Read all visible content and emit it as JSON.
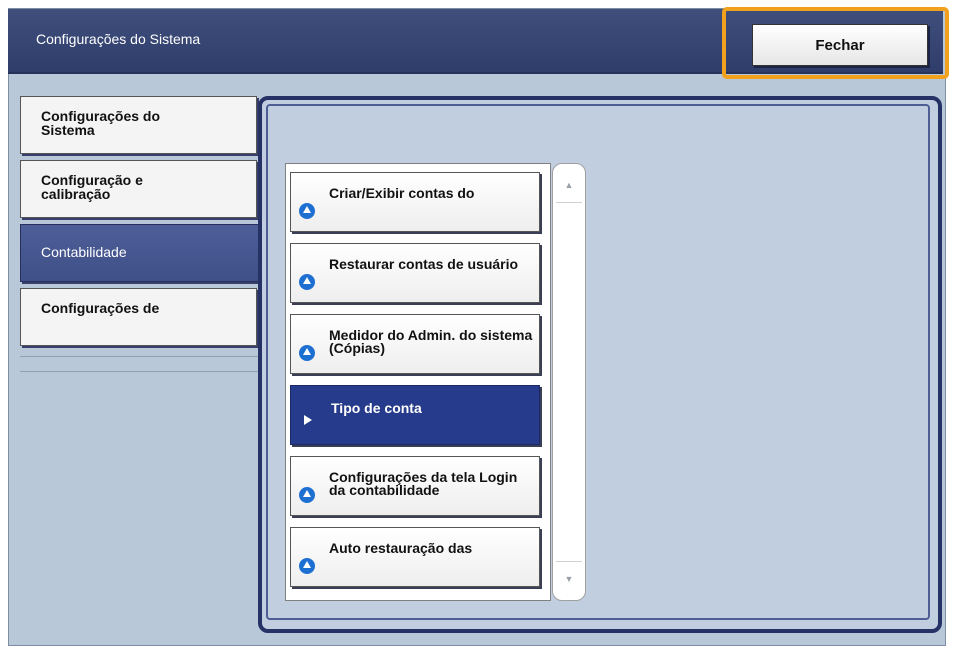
{
  "header": {
    "title": "Configurações do Sistema",
    "close_label": "Fechar",
    "highlight_color": "#f2a11f"
  },
  "sidebar": {
    "items": [
      {
        "label": "Configurações do\nSistema",
        "selected": false
      },
      {
        "label": "Configuração e\ncalibração",
        "selected": false
      },
      {
        "label": "Contabilidade",
        "selected": true
      },
      {
        "label": "Configurações de",
        "selected": false
      }
    ]
  },
  "menu": {
    "items": [
      {
        "label": "Criar/Exibir contas do",
        "icon": "blue-up-circle-icon"
      },
      {
        "label": "Restaurar contas de usuário",
        "icon": "blue-up-circle-icon"
      },
      {
        "label": "Medidor do Admin. do sistema (Cópias)",
        "icon": "blue-up-circle-icon"
      },
      {
        "label": "Tipo de conta",
        "icon": "play-icon",
        "selected": true
      },
      {
        "label": "Configurações da tela Login da contabilidade",
        "icon": "blue-up-circle-icon"
      },
      {
        "label": "Auto restauração das",
        "icon": "blue-up-circle-icon"
      }
    ]
  },
  "scroll": {
    "up_icon": "▲",
    "down_icon": "▼"
  }
}
